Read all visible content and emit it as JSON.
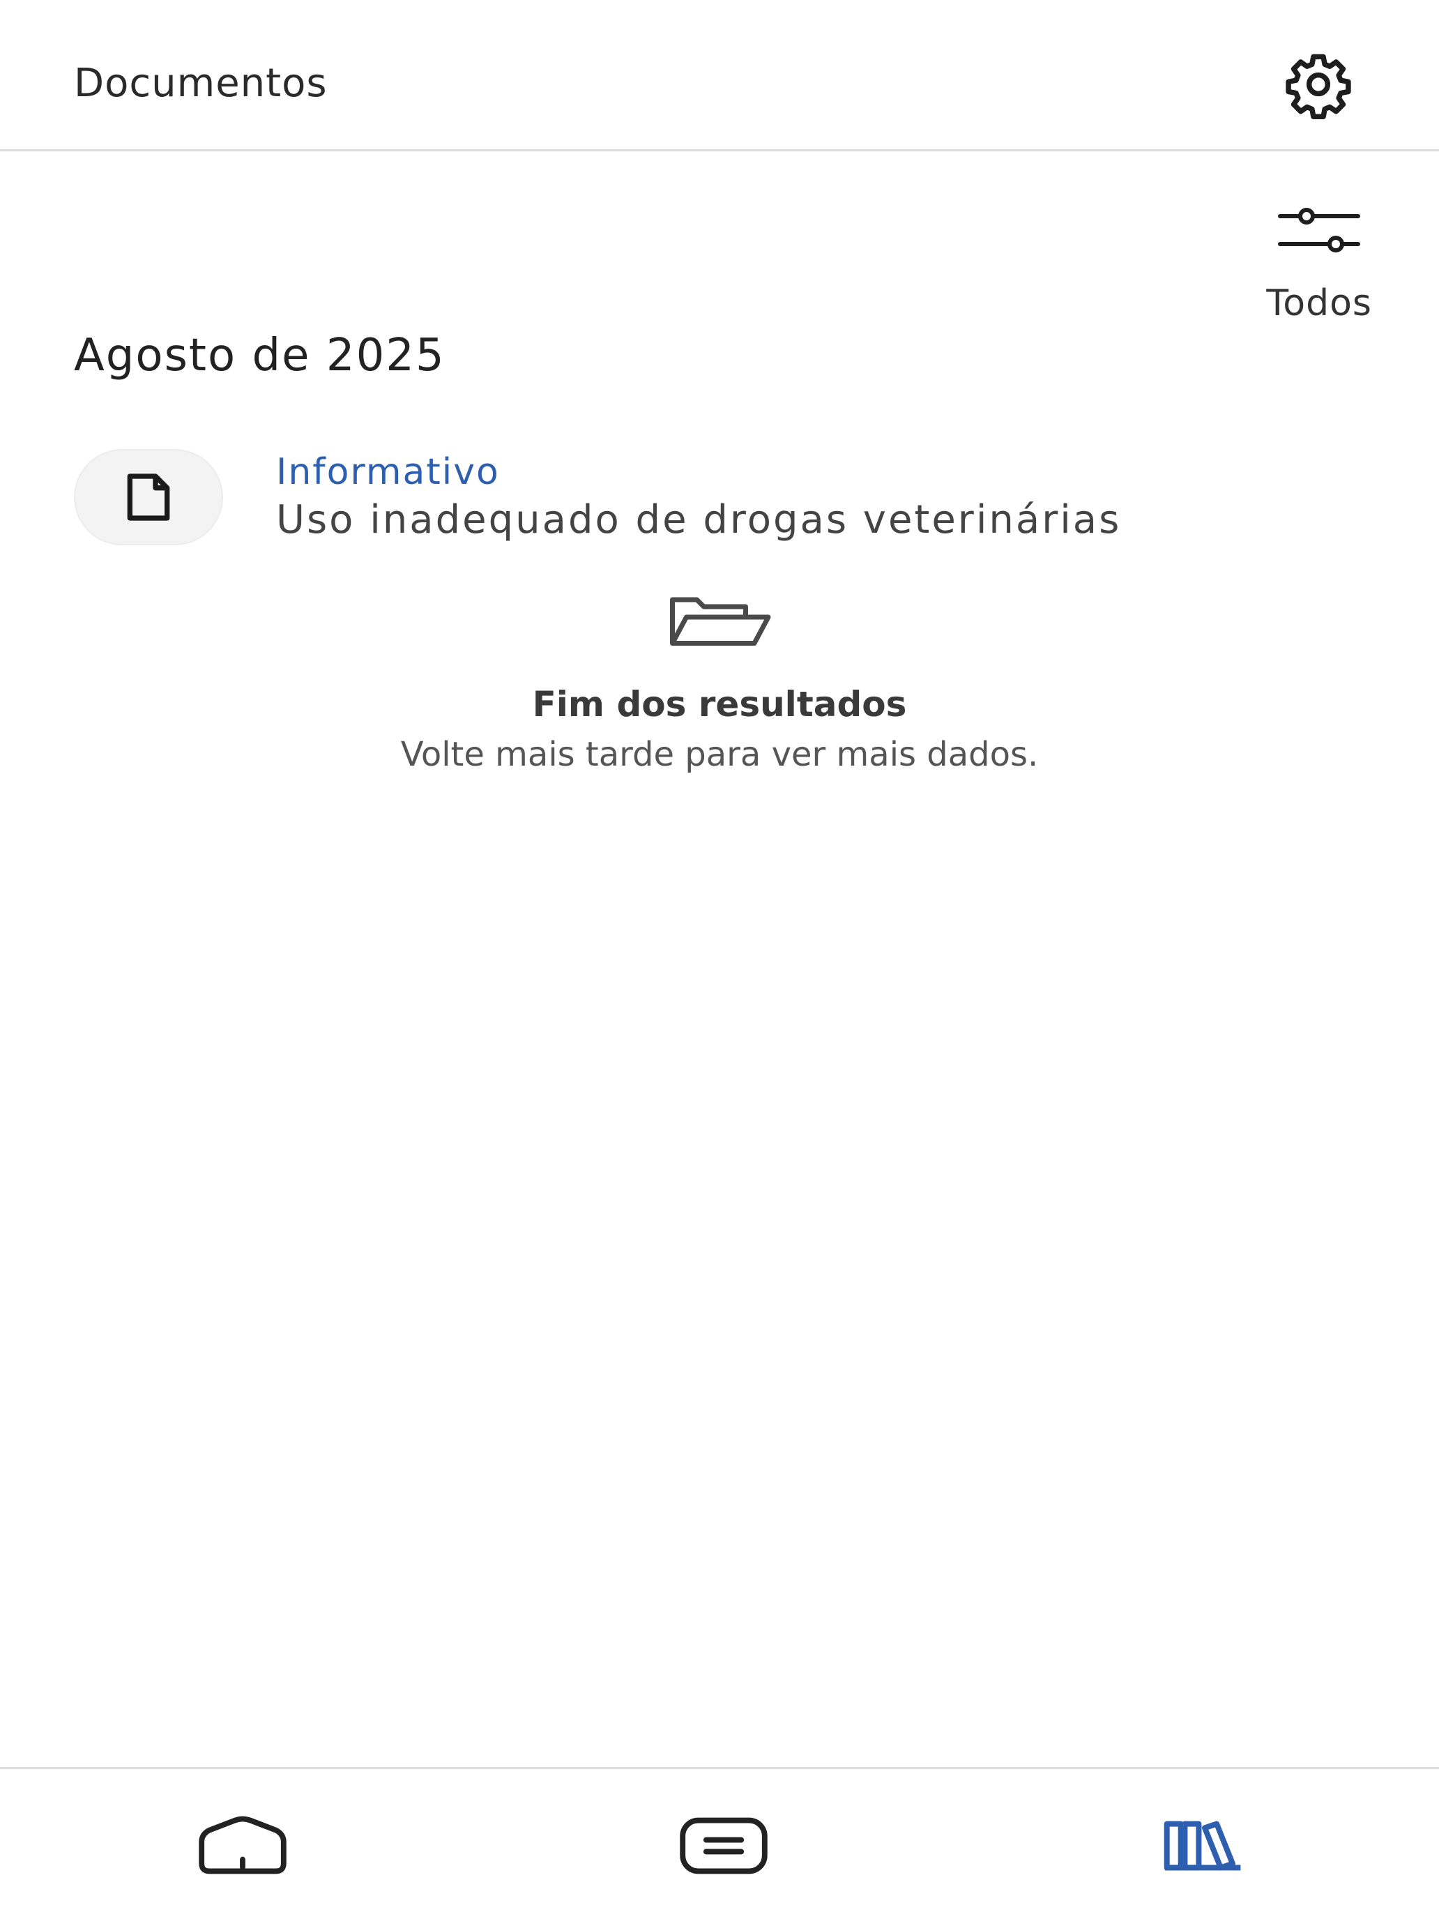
{
  "header": {
    "title": "Documentos",
    "settings_icon": "gear-icon"
  },
  "filter": {
    "label": "Todos",
    "icon": "sliders-icon"
  },
  "section": {
    "title": "Agosto de 2025"
  },
  "documents": [
    {
      "type": "Informativo",
      "title": "Uso inadequado de drogas veterinárias",
      "icon": "document-icon"
    }
  ],
  "end_of_results": {
    "icon": "folder-open-icon",
    "title": "Fim dos resultados",
    "subtitle": "Volte mais tarde para ver mais dados."
  },
  "bottom_nav": {
    "items": [
      {
        "icon": "home-icon",
        "active": false
      },
      {
        "icon": "list-icon",
        "active": false
      },
      {
        "icon": "library-icon",
        "active": true
      }
    ],
    "active_color": "#2e5fae",
    "inactive_color": "#222222"
  },
  "colors": {
    "accent": "#2e5fae",
    "text": "#222222",
    "divider": "#dcdcdc"
  }
}
